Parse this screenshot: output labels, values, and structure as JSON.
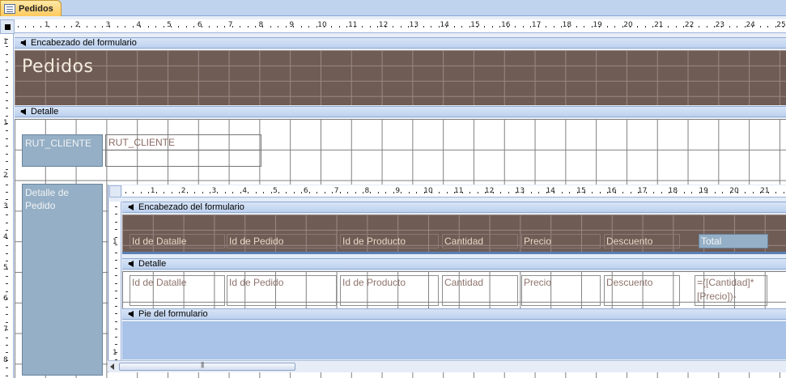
{
  "tab": {
    "title": "Pedidos",
    "icon": "form-icon"
  },
  "main_ruler": {
    "numbers": [
      "1",
      "2",
      "3",
      "4",
      "5",
      "6",
      "7",
      "8",
      "9",
      "10",
      "11",
      "12",
      "13",
      "14",
      "15",
      "16",
      "17",
      "18",
      "19",
      "20",
      "21",
      "22",
      "23",
      "24",
      "25"
    ]
  },
  "main_vruler": {
    "numbers": [
      "1",
      "1",
      "2",
      "3",
      "4",
      "5",
      "6",
      "7",
      "8"
    ]
  },
  "sections": {
    "header": "Encabezado del formulario",
    "detail": "Detalle"
  },
  "header": {
    "title": "Pedidos"
  },
  "detail": {
    "rut_label": "RUT_CLIENTE",
    "rut_field": "RUT_CLIENTE",
    "subform_label": "Detalle de Pedido"
  },
  "subform": {
    "ruler_numbers": [
      "1",
      "2",
      "3",
      "4",
      "5",
      "6",
      "7",
      "8",
      "9",
      "10",
      "11",
      "12",
      "13",
      "14",
      "15",
      "16",
      "17",
      "18",
      "19",
      "20",
      "21"
    ],
    "vruler_numbers": [
      "1",
      "1"
    ],
    "sections": {
      "header": "Encabezado del formulario",
      "detail": "Detalle",
      "footer": "Pie del formulario"
    },
    "header_labels": [
      "Id de Datalle",
      "Id de Pedido",
      "Id de Producto",
      "Cantidad",
      "Precio",
      "Descuento"
    ],
    "total_label": "Total",
    "detail_fields": [
      "Id de Datalle",
      "Id de Pedido",
      "Id de Producto",
      "Cantidad",
      "Precio",
      "Descuento"
    ],
    "total_formula_line1": "=([Cantidad]*",
    "total_formula_line2": "[Precio])-"
  },
  "colors": {
    "header_bg": "#6f5c55",
    "label_bg": "#94afc6",
    "accent": "#ffc95e"
  }
}
